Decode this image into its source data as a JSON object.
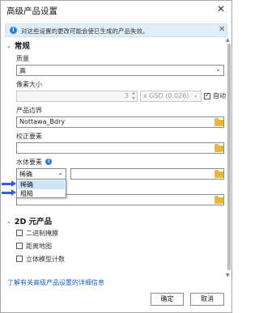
{
  "dialog": {
    "title": "高级产品设置",
    "close_glyph": "✕"
  },
  "notice": {
    "icon_glyph": "i",
    "text": "对这些设置的更改可能会使已生成的产品失效。",
    "close_glyph": "✕"
  },
  "sections": {
    "general": {
      "label": "常规",
      "chevron": "⌄"
    },
    "products_2d": {
      "label": "2D 元产品",
      "chevron": "⌄"
    }
  },
  "quality": {
    "label": "质量",
    "value": "高"
  },
  "pixel_size": {
    "label": "像素大小",
    "value": "3",
    "unit_value": "x GSD (0.026)",
    "auto_checked": true,
    "auto_label": "自动"
  },
  "product_boundary": {
    "label": "产品边界",
    "value": "Nottawa_Bdry"
  },
  "correction_features": {
    "label": "校正要素",
    "value": ""
  },
  "water_features": {
    "label": "水体要素",
    "info_glyph": "i",
    "type_value": "稀确",
    "layer_value": "",
    "options": [
      "稀确",
      "粗糙"
    ],
    "highlighted_option": "稀确"
  },
  "hidden_row": {
    "value": ""
  },
  "products_2d_items": [
    {
      "label": "二进制掩膜",
      "checked": false
    },
    {
      "label": "距离地图",
      "checked": false
    },
    {
      "label": "立体模型计数",
      "checked": false
    }
  ],
  "footer": {
    "learn_more_link": "了解有关高级产品设置的详细信息",
    "ok_label": "确定",
    "cancel_label": "取消"
  },
  "glyphs": {
    "dropdown_arrow": "⌄",
    "spin_up": "▲",
    "spin_down": "▼",
    "scroll_up": "▲",
    "scroll_down": "▼"
  },
  "colors": {
    "accent": "#2f7dd1",
    "annotation_arrow": "#3b5bdb",
    "folder": "#e9b83b",
    "notice_bg": "#e0eefa",
    "highlight": "#cde3f7",
    "link": "#1a5fb4"
  }
}
